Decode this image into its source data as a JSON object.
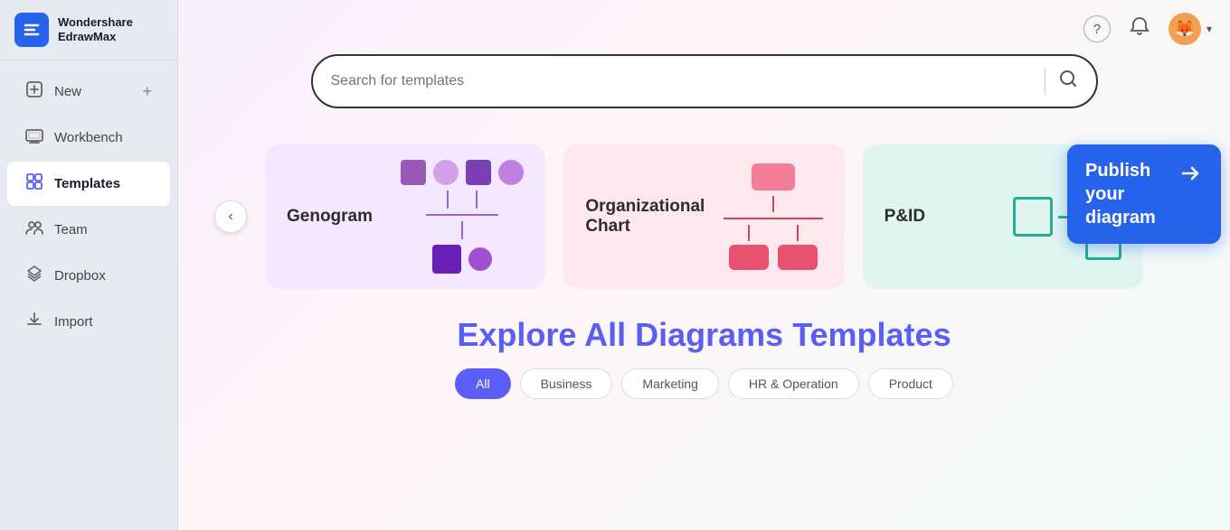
{
  "app": {
    "brand_line1": "Wondershare",
    "brand_line2": "EdrawMax",
    "logo_char": "W"
  },
  "sidebar": {
    "items": [
      {
        "id": "new",
        "label": "New",
        "icon": "➕",
        "has_plus": true
      },
      {
        "id": "workbench",
        "label": "Workbench",
        "icon": "🖥"
      },
      {
        "id": "templates",
        "label": "Templates",
        "icon": "🗂",
        "active": true
      },
      {
        "id": "team",
        "label": "Team",
        "icon": "👥"
      },
      {
        "id": "dropbox",
        "label": "Dropbox",
        "icon": "📦"
      },
      {
        "id": "import",
        "label": "Import",
        "icon": "📥"
      }
    ]
  },
  "topbar": {
    "help_icon": "?",
    "bell_icon": "🔔",
    "avatar_emoji": "🦊"
  },
  "search": {
    "placeholder": "Search for templates"
  },
  "publish": {
    "label": "Publish your diagram",
    "arrow": "➤"
  },
  "carousel": {
    "cards": [
      {
        "id": "genogram",
        "label": "Genogram",
        "bg_class": "card-genogram"
      },
      {
        "id": "org-chart",
        "label": "Organizational Chart",
        "bg_class": "card-org"
      },
      {
        "id": "pid",
        "label": "P&ID",
        "bg_class": "card-pid"
      }
    ]
  },
  "explore": {
    "title_static": "Explore",
    "title_accent": "All Diagrams Templates",
    "categories": [
      {
        "id": "all",
        "label": "All",
        "active": true
      },
      {
        "id": "business",
        "label": "Business"
      },
      {
        "id": "marketing",
        "label": "Marketing"
      },
      {
        "id": "hr-operation",
        "label": "HR & Operation"
      },
      {
        "id": "product",
        "label": "Product"
      }
    ]
  }
}
